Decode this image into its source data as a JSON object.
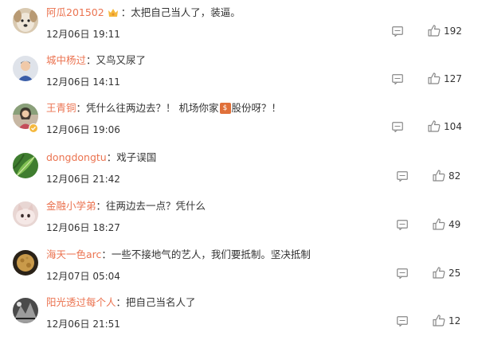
{
  "comments": [
    {
      "user": "阿瓜201502",
      "has_crown": true,
      "colon": "：",
      "text": "太把自己当人了，装逼。",
      "time": "12月06日 19:11",
      "likes": "192",
      "avatar_icon": "dog-avatar"
    },
    {
      "user": "城中杨过",
      "colon": "：",
      "text": "又鸟又尿了",
      "time": "12月06日 14:11",
      "likes": "127",
      "avatar_icon": "person-avatar"
    },
    {
      "user": "王青铜",
      "colon": "：",
      "text_before": "凭什么往两边去？！ 机场你家",
      "stock_label": "$",
      "text_after": "股份呀？！",
      "time": "12月06日 19:06",
      "likes": "104",
      "avatar_icon": "woman-avatar",
      "verified": true
    },
    {
      "user": "dongdongtu",
      "colon": "：",
      "text": "戏子误国",
      "time": "12月06日 21:42",
      "likes": "82",
      "avatar_icon": "leaf-avatar"
    },
    {
      "user": "金融小学弟",
      "colon": "：",
      "text": "往两边去一点？凭什么",
      "time": "12月06日 18:27",
      "likes": "49",
      "avatar_icon": "cat-avatar"
    },
    {
      "user": "海天一色arc",
      "colon": "：",
      "text": "一些不接地气的艺人，我们要抵制。坚决抵制",
      "time": "12月07日 05:04",
      "likes": "25",
      "avatar_icon": "moon-avatar"
    },
    {
      "user": "阳光透过每个人",
      "colon": "：",
      "text": "把自己当名人了",
      "time": "12月06日 21:51",
      "likes": "12",
      "avatar_icon": "photo-avatar"
    }
  ],
  "colors": {
    "username": "#eb7350",
    "text": "#333333",
    "icon": "#888888"
  }
}
